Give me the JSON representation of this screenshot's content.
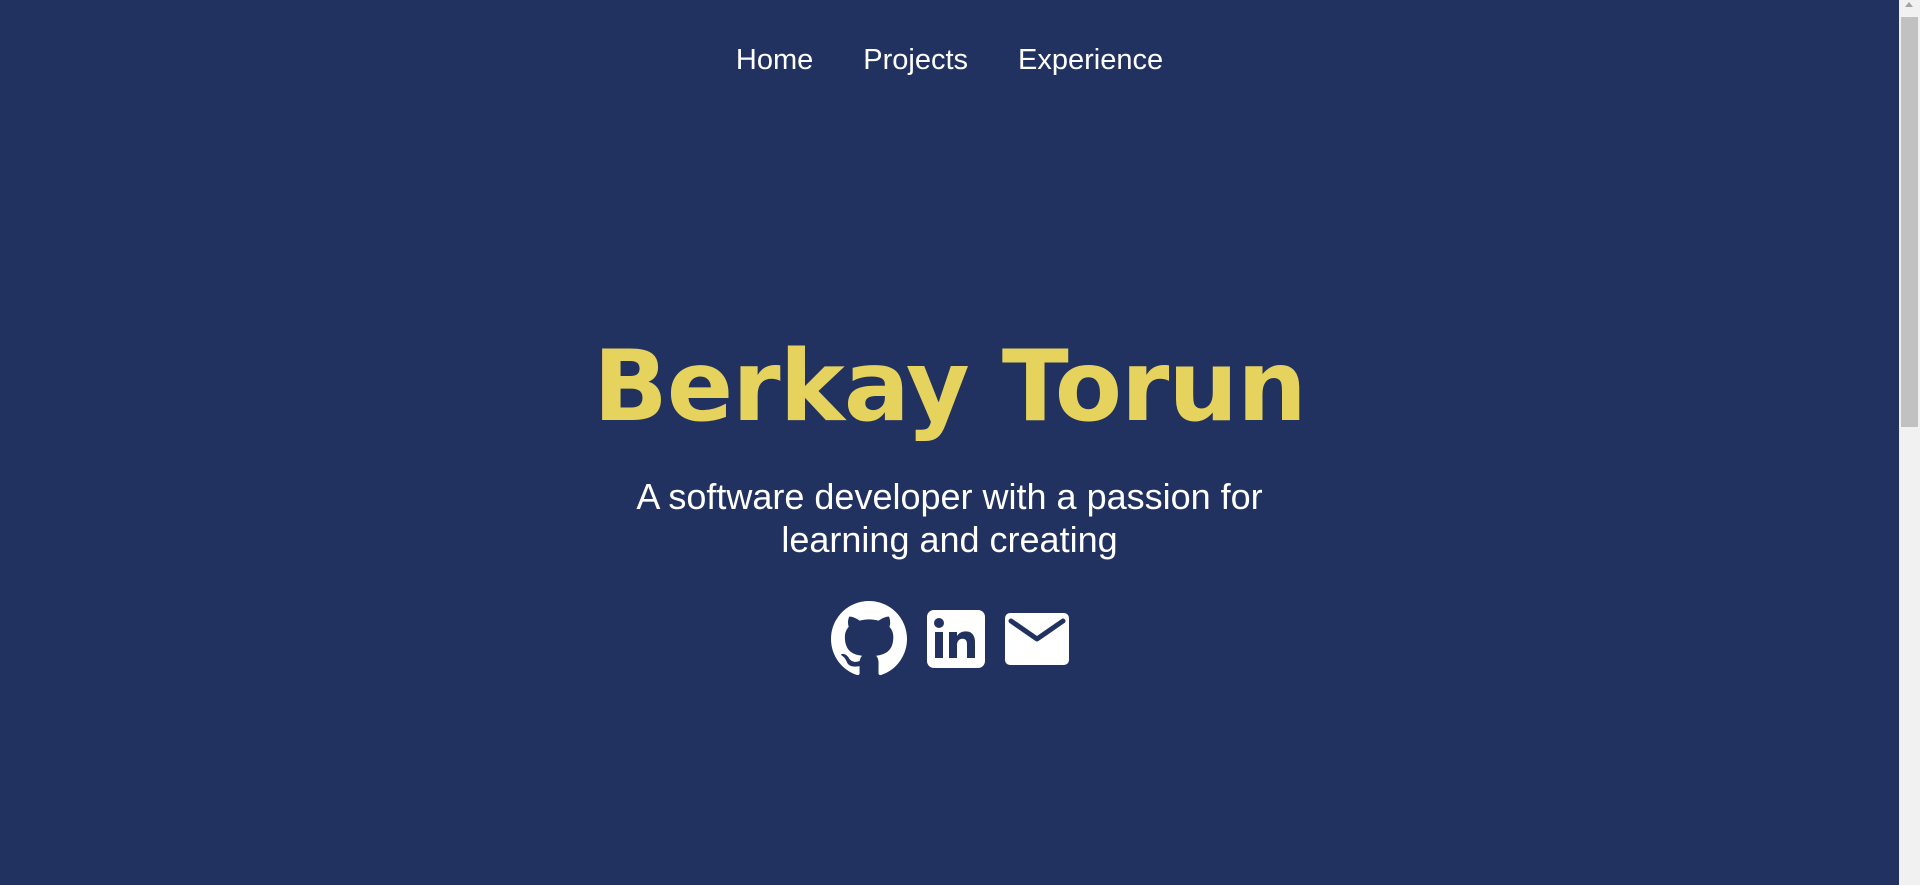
{
  "nav": {
    "items": [
      {
        "label": "Home"
      },
      {
        "label": "Projects"
      },
      {
        "label": "Experience"
      }
    ]
  },
  "hero": {
    "name": "Berkay Torun",
    "tagline": "A software developer with a passion for learning and creating"
  },
  "socials": [
    {
      "icon": "github-icon"
    },
    {
      "icon": "linkedin-icon"
    },
    {
      "icon": "mail-icon"
    }
  ],
  "colors": {
    "background": "#223260",
    "accent": "#e5d35e",
    "text": "#ffffff"
  }
}
